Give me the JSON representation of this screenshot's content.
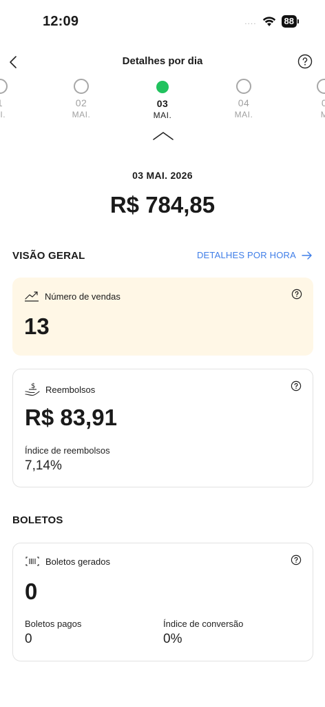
{
  "status_bar": {
    "time": "12:09",
    "signal": "....",
    "battery": "88"
  },
  "nav": {
    "title": "Detalhes por dia"
  },
  "days": [
    {
      "num": "1",
      "month": "AI."
    },
    {
      "num": "02",
      "month": "MAI."
    },
    {
      "num": "03",
      "month": "MAI.",
      "selected": true
    },
    {
      "num": "04",
      "month": "MAI."
    },
    {
      "num": "0",
      "month": "M"
    }
  ],
  "summary": {
    "date": "03 MAI. 2026",
    "total": "R$ 784,85"
  },
  "overview": {
    "title": "VISÃO GERAL",
    "hour_details_link": "DETALHES POR HORA",
    "sales": {
      "label": "Número de vendas",
      "value": "13"
    },
    "refunds": {
      "label": "Reembolsos",
      "value": "R$ 83,91",
      "rate_label": "Índice de reembolsos",
      "rate_value": "7,14%"
    }
  },
  "boletos": {
    "title": "BOLETOS",
    "generated_label": "Boletos gerados",
    "generated_value": "0",
    "paid_label": "Boletos pagos",
    "paid_value": "0",
    "conversion_label": "Índice de conversão",
    "conversion_value": "0%"
  },
  "colors": {
    "accent_green": "#21c25e",
    "link_blue": "#3f7ee8",
    "sales_card_bg": "#fff7e6"
  }
}
